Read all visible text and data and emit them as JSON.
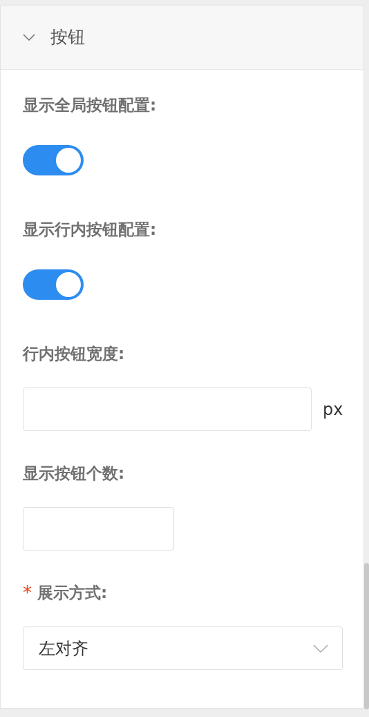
{
  "panel": {
    "title": "按钮",
    "expanded": true
  },
  "fields": [
    {
      "kind": "switch",
      "label": "显示全局按钮配置:",
      "required": false,
      "on": true
    },
    {
      "kind": "switch",
      "label": "显示行内按钮配置:",
      "required": false,
      "on": true
    },
    {
      "kind": "input",
      "label": "行内按钮宽度:",
      "required": false,
      "suffix": "px"
    },
    {
      "kind": "short-input",
      "label": "显示按钮个数:",
      "required": false
    },
    {
      "kind": "select",
      "label": "展示方式:",
      "required": true,
      "required_mark": "*",
      "value": "左对齐"
    }
  ]
}
